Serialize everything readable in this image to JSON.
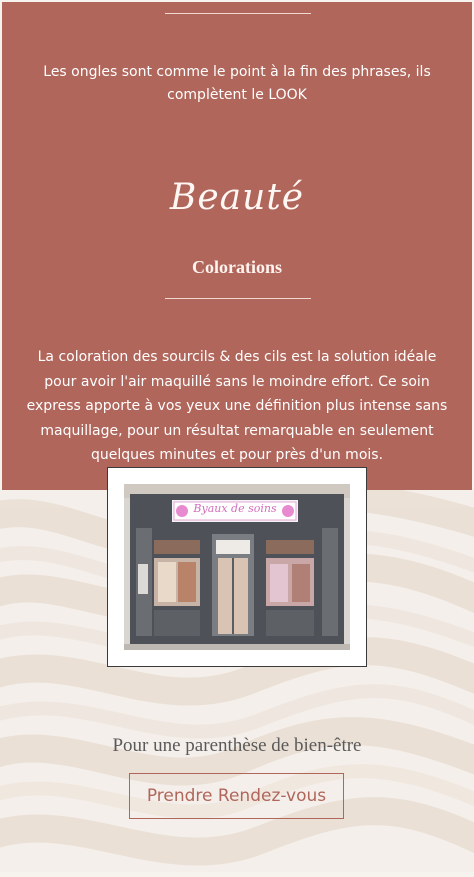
{
  "nails": {
    "text": "Les ongles sont comme le point à la fin des phrases, ils complètent le LOOK"
  },
  "beauty": {
    "script_title": "Beauté",
    "heading": "Colorations",
    "description": "La coloration des sourcils & des cils est la solution idéale pour avoir l'air maquillé sans le moindre effort. Ce soin express apporte à vos yeux une définition plus intense sans maquillage, pour un résultat remarquable en seulement quelques minutes et pour près d'un mois."
  },
  "shop": {
    "sign_text": "Byaux de soins"
  },
  "footer": {
    "tagline": "Pour une parenthèse de bien-être",
    "cta_label": "Prendre Rendez-vous"
  },
  "colors": {
    "brand": "#b0665b",
    "background": "#f4efea",
    "text_light": "#ffffff"
  }
}
